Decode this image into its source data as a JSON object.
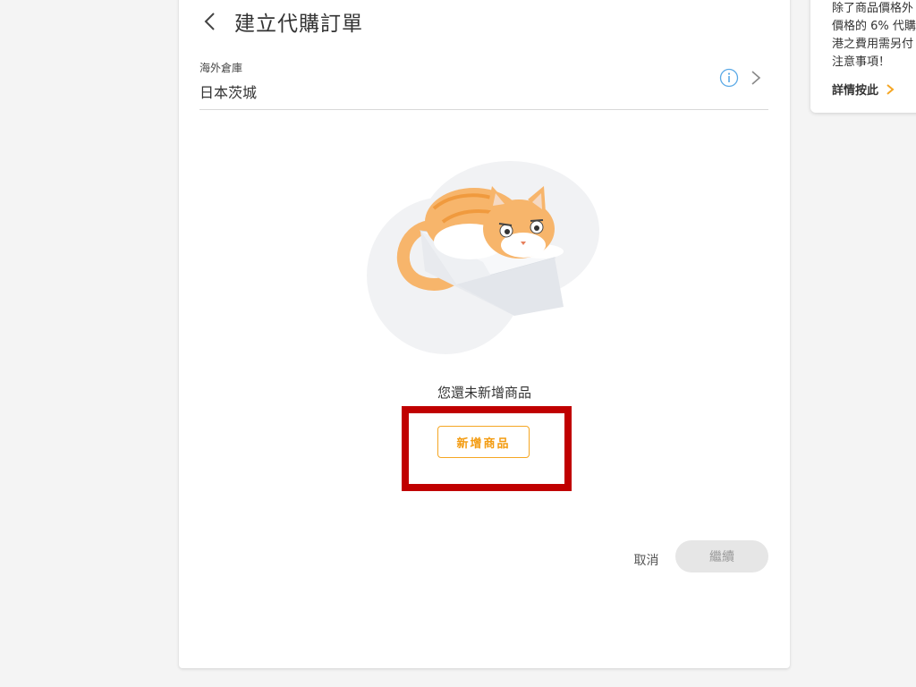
{
  "header": {
    "title": "建立代購訂單"
  },
  "warehouse": {
    "label": "海外倉庫",
    "value": "日本茨城"
  },
  "empty_state": {
    "message": "您還未新增商品",
    "add_button": "新增商品"
  },
  "footer": {
    "cancel": "取消",
    "continue": "繼續"
  },
  "side_notice": {
    "lines": [
      "除了商品價格外",
      "價格的 6% 代購",
      "港之費用需另付",
      "注意事項！"
    ],
    "more_link": "詳情按此"
  },
  "colors": {
    "accent": "#f5a623",
    "highlight": "#c00000",
    "info_icon": "#5aa9e6"
  }
}
